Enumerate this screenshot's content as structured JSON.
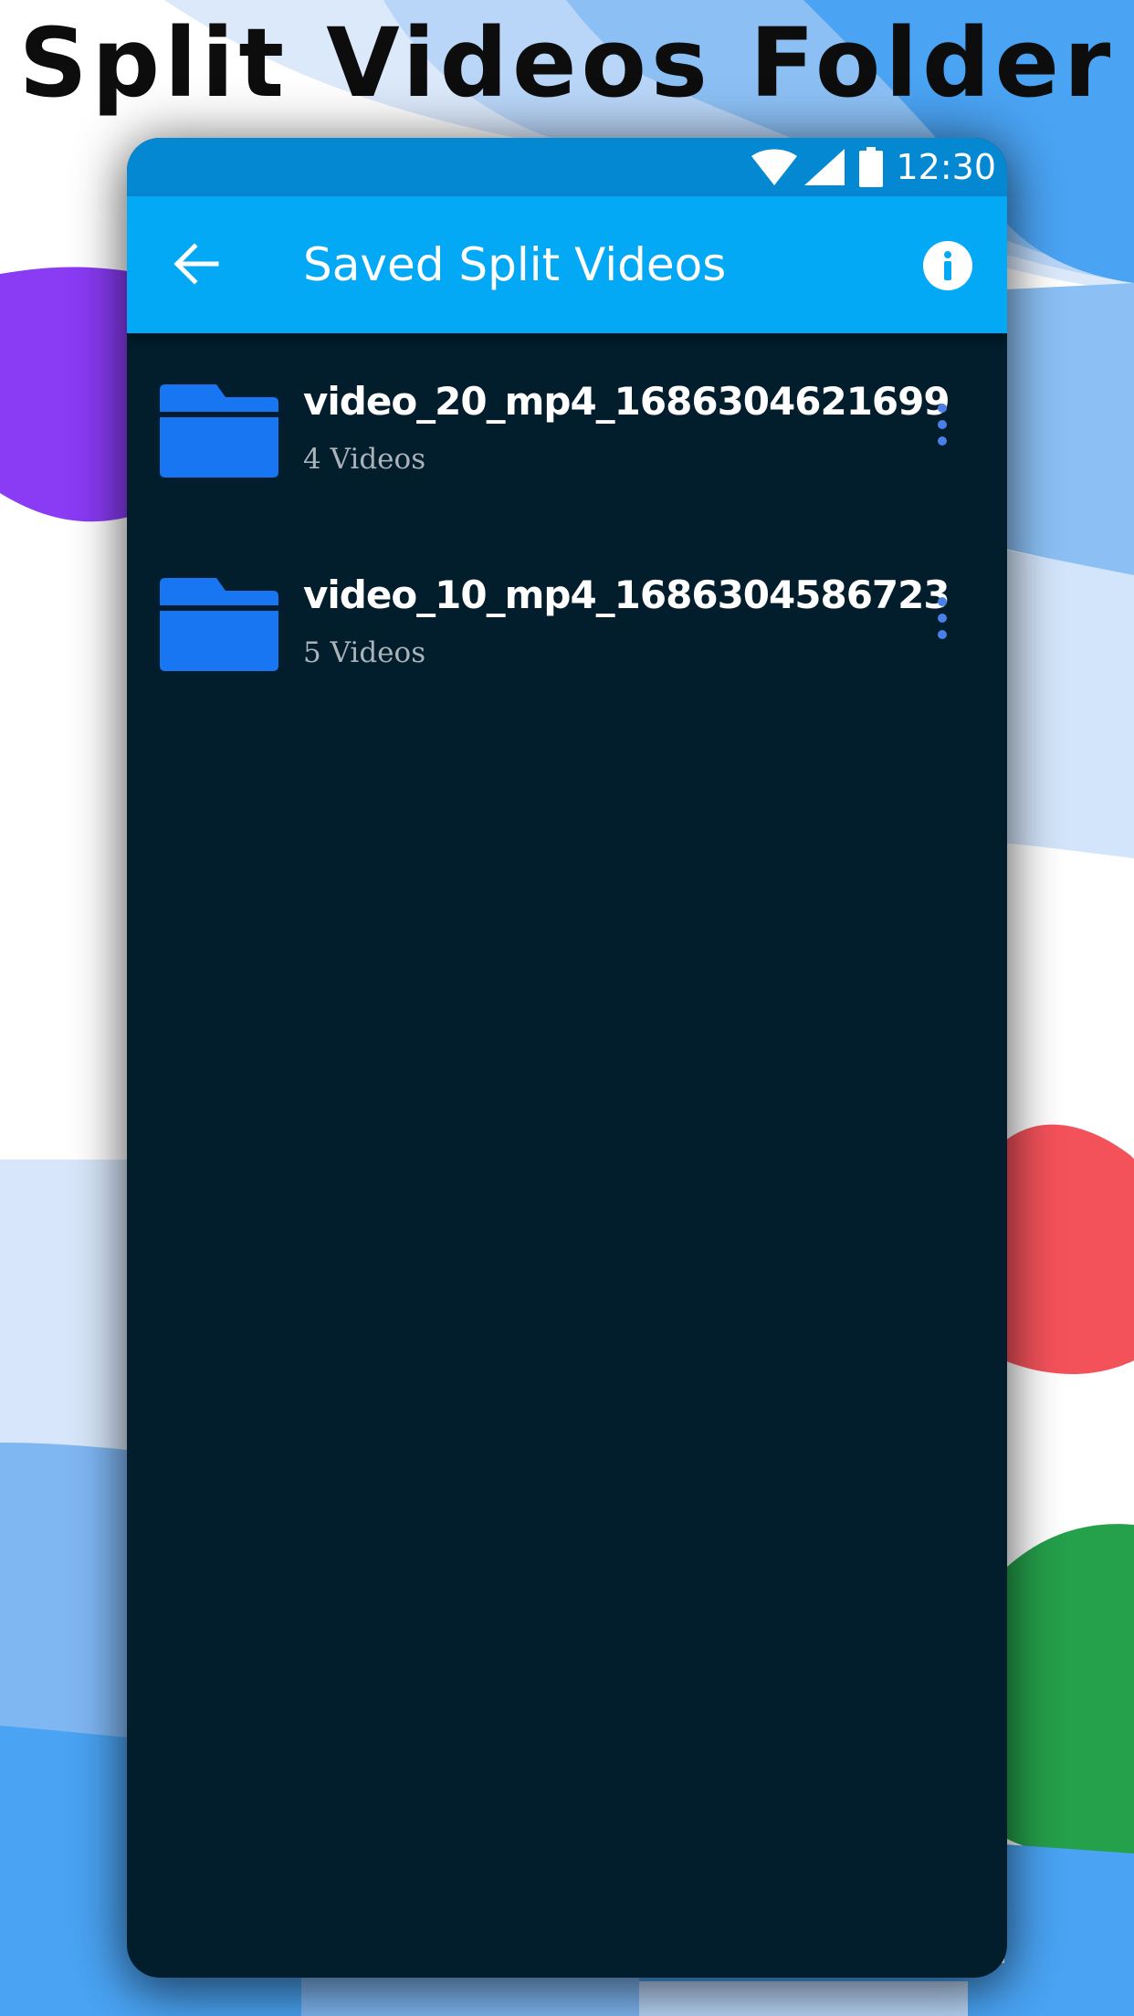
{
  "promo": {
    "title": "Split Videos Folder"
  },
  "status_bar": {
    "time": "12:30",
    "icons": [
      "wifi-icon",
      "signal-icon",
      "battery-icon"
    ]
  },
  "toolbar": {
    "title": "Saved Split Videos",
    "back_icon": "arrow-left-icon",
    "info_icon": "info-icon"
  },
  "folders": [
    {
      "name": "video_20_mp4_1686304621699",
      "count": "4 Videos"
    },
    {
      "name": "video_10_mp4_1686304586723",
      "count": "5 Videos"
    }
  ],
  "colors": {
    "status_bar": "#0488d1",
    "toolbar": "#03a9f4",
    "screen_bg": "#021d2c",
    "folder_icon": "#1976f2",
    "more_icon": "#4a7fe6"
  }
}
